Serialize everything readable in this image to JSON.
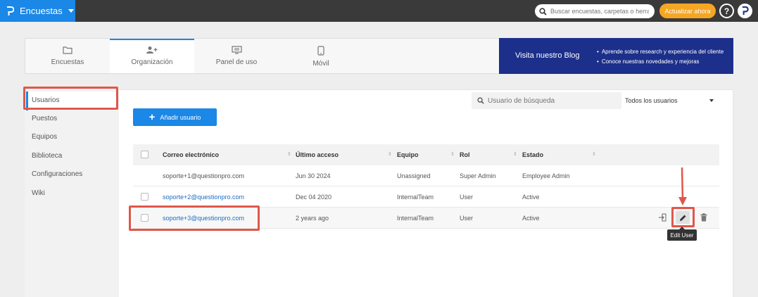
{
  "header": {
    "app_title": "Encuestas",
    "search_placeholder": "Buscar encuestas, carpetas o herrami",
    "update_label": "Actualizar ahora",
    "help_label": "?"
  },
  "tabs": [
    {
      "label": "Encuestas",
      "icon": "folder-icon"
    },
    {
      "label": "Organización",
      "icon": "user-add-icon"
    },
    {
      "label": "Panel de uso",
      "icon": "monitor-icon"
    },
    {
      "label": "Móvil",
      "icon": "mobile-icon"
    }
  ],
  "blog": {
    "title": "Visita nuestro Blog",
    "bullets": [
      "Aprende sobre research y experiencia del cliente",
      "Conoce nuestras novedades y mejoras"
    ]
  },
  "sidebar": {
    "items": [
      {
        "label": "Usuarios"
      },
      {
        "label": "Puestos"
      },
      {
        "label": "Equipos"
      },
      {
        "label": "Biblioteca"
      },
      {
        "label": "Configuraciones"
      },
      {
        "label": "Wiki"
      }
    ]
  },
  "toolbar": {
    "search_placeholder": "Usuario de búsqueda",
    "filter_value": "Todos los usuarios",
    "add_label": "Añadir usuario"
  },
  "table": {
    "columns": [
      "Correo electrónico",
      "Último acceso",
      "Equipo",
      "Rol",
      "Estado"
    ],
    "rows": [
      {
        "email": "soporte+1@questionpro.com",
        "last": "Jun 30 2024",
        "team": "Unassigned",
        "role": "Super Admin",
        "status": "Employee Admin"
      },
      {
        "email": "soporte+2@questionpro.com",
        "last": "Dec 04 2020",
        "team": "InternalTeam",
        "role": "User",
        "status": "Active"
      },
      {
        "email": "soporte+3@questionpro.com",
        "last": "2 years ago",
        "team": "InternalTeam",
        "role": "User",
        "status": "Active"
      }
    ]
  },
  "tooltip": "Edit User",
  "colors": {
    "brand": "#1b87e6",
    "highlight": "#e0574a",
    "update": "#f5a623",
    "blog": "#1c2f8a"
  }
}
